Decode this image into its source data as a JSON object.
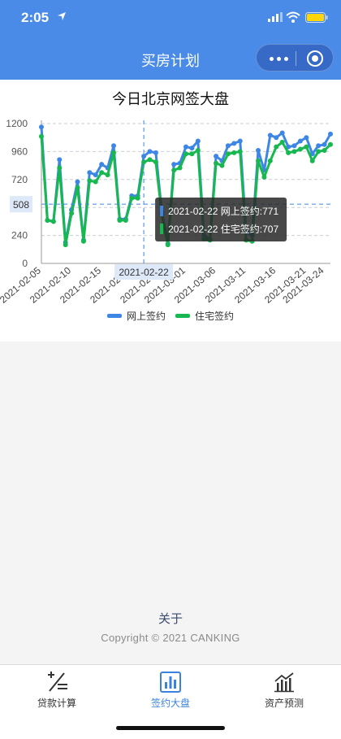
{
  "status_bar": {
    "time": "2:05"
  },
  "nav": {
    "title": "买房计划"
  },
  "chart_data": {
    "type": "line",
    "title": "今日北京网签大盘",
    "ylim": [
      0,
      1200
    ],
    "yticks": [
      0,
      240,
      480,
      720,
      960,
      1200
    ],
    "ytick_labels": [
      "0",
      "240",
      "",
      "720",
      "960",
      "1200"
    ],
    "x": [
      "2021-02-05",
      "2021-02-06",
      "2021-02-07",
      "2021-02-08",
      "2021-02-09",
      "2021-02-10",
      "2021-02-11",
      "2021-02-12",
      "2021-02-13",
      "2021-02-14",
      "2021-02-15",
      "2021-02-16",
      "2021-02-17",
      "2021-02-18",
      "2021-02-19",
      "2021-02-20",
      "2021-02-21",
      "2021-02-22",
      "2021-02-23",
      "2021-02-24",
      "2021-02-25",
      "2021-02-26",
      "2021-02-27",
      "2021-02-28",
      "2021-03-01",
      "2021-03-02",
      "2021-03-03",
      "2021-03-04",
      "2021-03-05",
      "2021-03-06",
      "2021-03-07",
      "2021-03-08",
      "2021-03-09",
      "2021-03-10",
      "2021-03-11",
      "2021-03-12",
      "2021-03-13",
      "2021-03-14",
      "2021-03-15",
      "2021-03-16",
      "2021-03-17",
      "2021-03-18",
      "2021-03-19",
      "2021-03-20",
      "2021-03-21",
      "2021-03-22",
      "2021-03-23",
      "2021-03-24",
      "2021-03-25"
    ],
    "xtick_labels": [
      "2021-02-05",
      "2021-02-10",
      "2021-02-15",
      "2021-02-20",
      "2021-02-22",
      "2021-02-25",
      "2021-03-01",
      "2021-03-06",
      "2021-03-11",
      "2021-03-16",
      "2021-03-21",
      "2021-03-24"
    ],
    "series": [
      {
        "name": "网上签约",
        "color": "#3d86e6",
        "values": [
          1170,
          370,
          360,
          890,
          180,
          460,
          700,
          200,
          780,
          760,
          850,
          820,
          1010,
          380,
          380,
          580,
          580,
          920,
          960,
          950,
          440,
          170,
          850,
          860,
          1000,
          990,
          1050,
          240,
          210,
          920,
          880,
          1010,
          1030,
          1050,
          270,
          240,
          970,
          800,
          1100,
          1080,
          1120,
          1000,
          1010,
          1050,
          1080,
          940,
          1010,
          1020,
          1110
        ]
      },
      {
        "name": "住宅签约",
        "color": "#16b84f",
        "values": [
          1090,
          370,
          360,
          820,
          160,
          430,
          650,
          190,
          710,
          700,
          780,
          760,
          950,
          370,
          370,
          560,
          560,
          870,
          890,
          870,
          420,
          160,
          800,
          820,
          940,
          940,
          970,
          210,
          200,
          860,
          840,
          940,
          950,
          960,
          200,
          190,
          880,
          740,
          880,
          1000,
          1040,
          950,
          960,
          980,
          1000,
          880,
          960,
          970,
          1020
        ]
      }
    ],
    "legend_position": "bottom",
    "grid": true,
    "crosshair": {
      "x": "2021-02-22",
      "y_label": "508"
    },
    "tooltip": [
      {
        "series": "网上签约",
        "text": "2021-02-22 网上签约:771"
      },
      {
        "series": "住宅签约",
        "text": "2021-02-22 住宅签约:707"
      }
    ]
  },
  "footer": {
    "about": "关于",
    "copyright": "Copyright © 2021 CANKING"
  },
  "tabs": [
    {
      "label": "贷款计算",
      "icon": "calculator-icon",
      "active": false
    },
    {
      "label": "签约大盘",
      "icon": "bar-chart-icon",
      "active": true
    },
    {
      "label": "资产预测",
      "icon": "trend-chart-icon",
      "active": false
    }
  ]
}
